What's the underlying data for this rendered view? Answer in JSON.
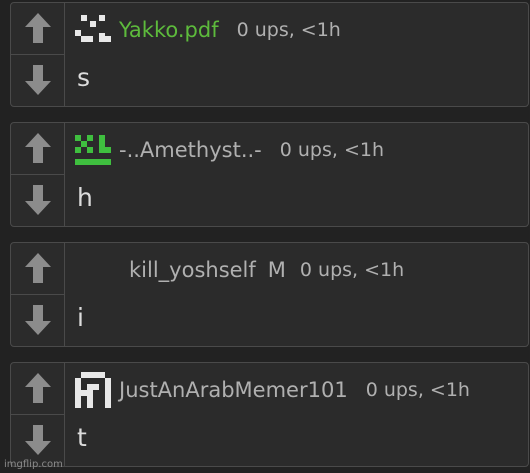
{
  "comments": [
    {
      "username": "Yakko.pdf",
      "meta": "0 ups, <1h",
      "text": "s",
      "badge": "",
      "avatar": "pixel-face-avatar"
    },
    {
      "username": "-..Amethyst..-",
      "meta": "0 ups, <1h",
      "text": "h",
      "badge": "",
      "avatar": "green-pixel-avatar"
    },
    {
      "username": "kill_yoshself",
      "meta": "0 ups, <1h",
      "text": "i",
      "badge": "M",
      "avatar": ""
    },
    {
      "username": "JustAnArabMemer101",
      "meta": "0 ups, <1h",
      "text": "t",
      "badge": "",
      "avatar": "white-pixel-avatar"
    }
  ],
  "watermark": "imgflip.com",
  "colors": {
    "background": "#222222",
    "panel": "#2b2b2b",
    "border": "#4a4a4a",
    "username_green": "#5dbb3c",
    "text_muted": "#b0b0b0",
    "arrow": "#8c8c8c"
  }
}
